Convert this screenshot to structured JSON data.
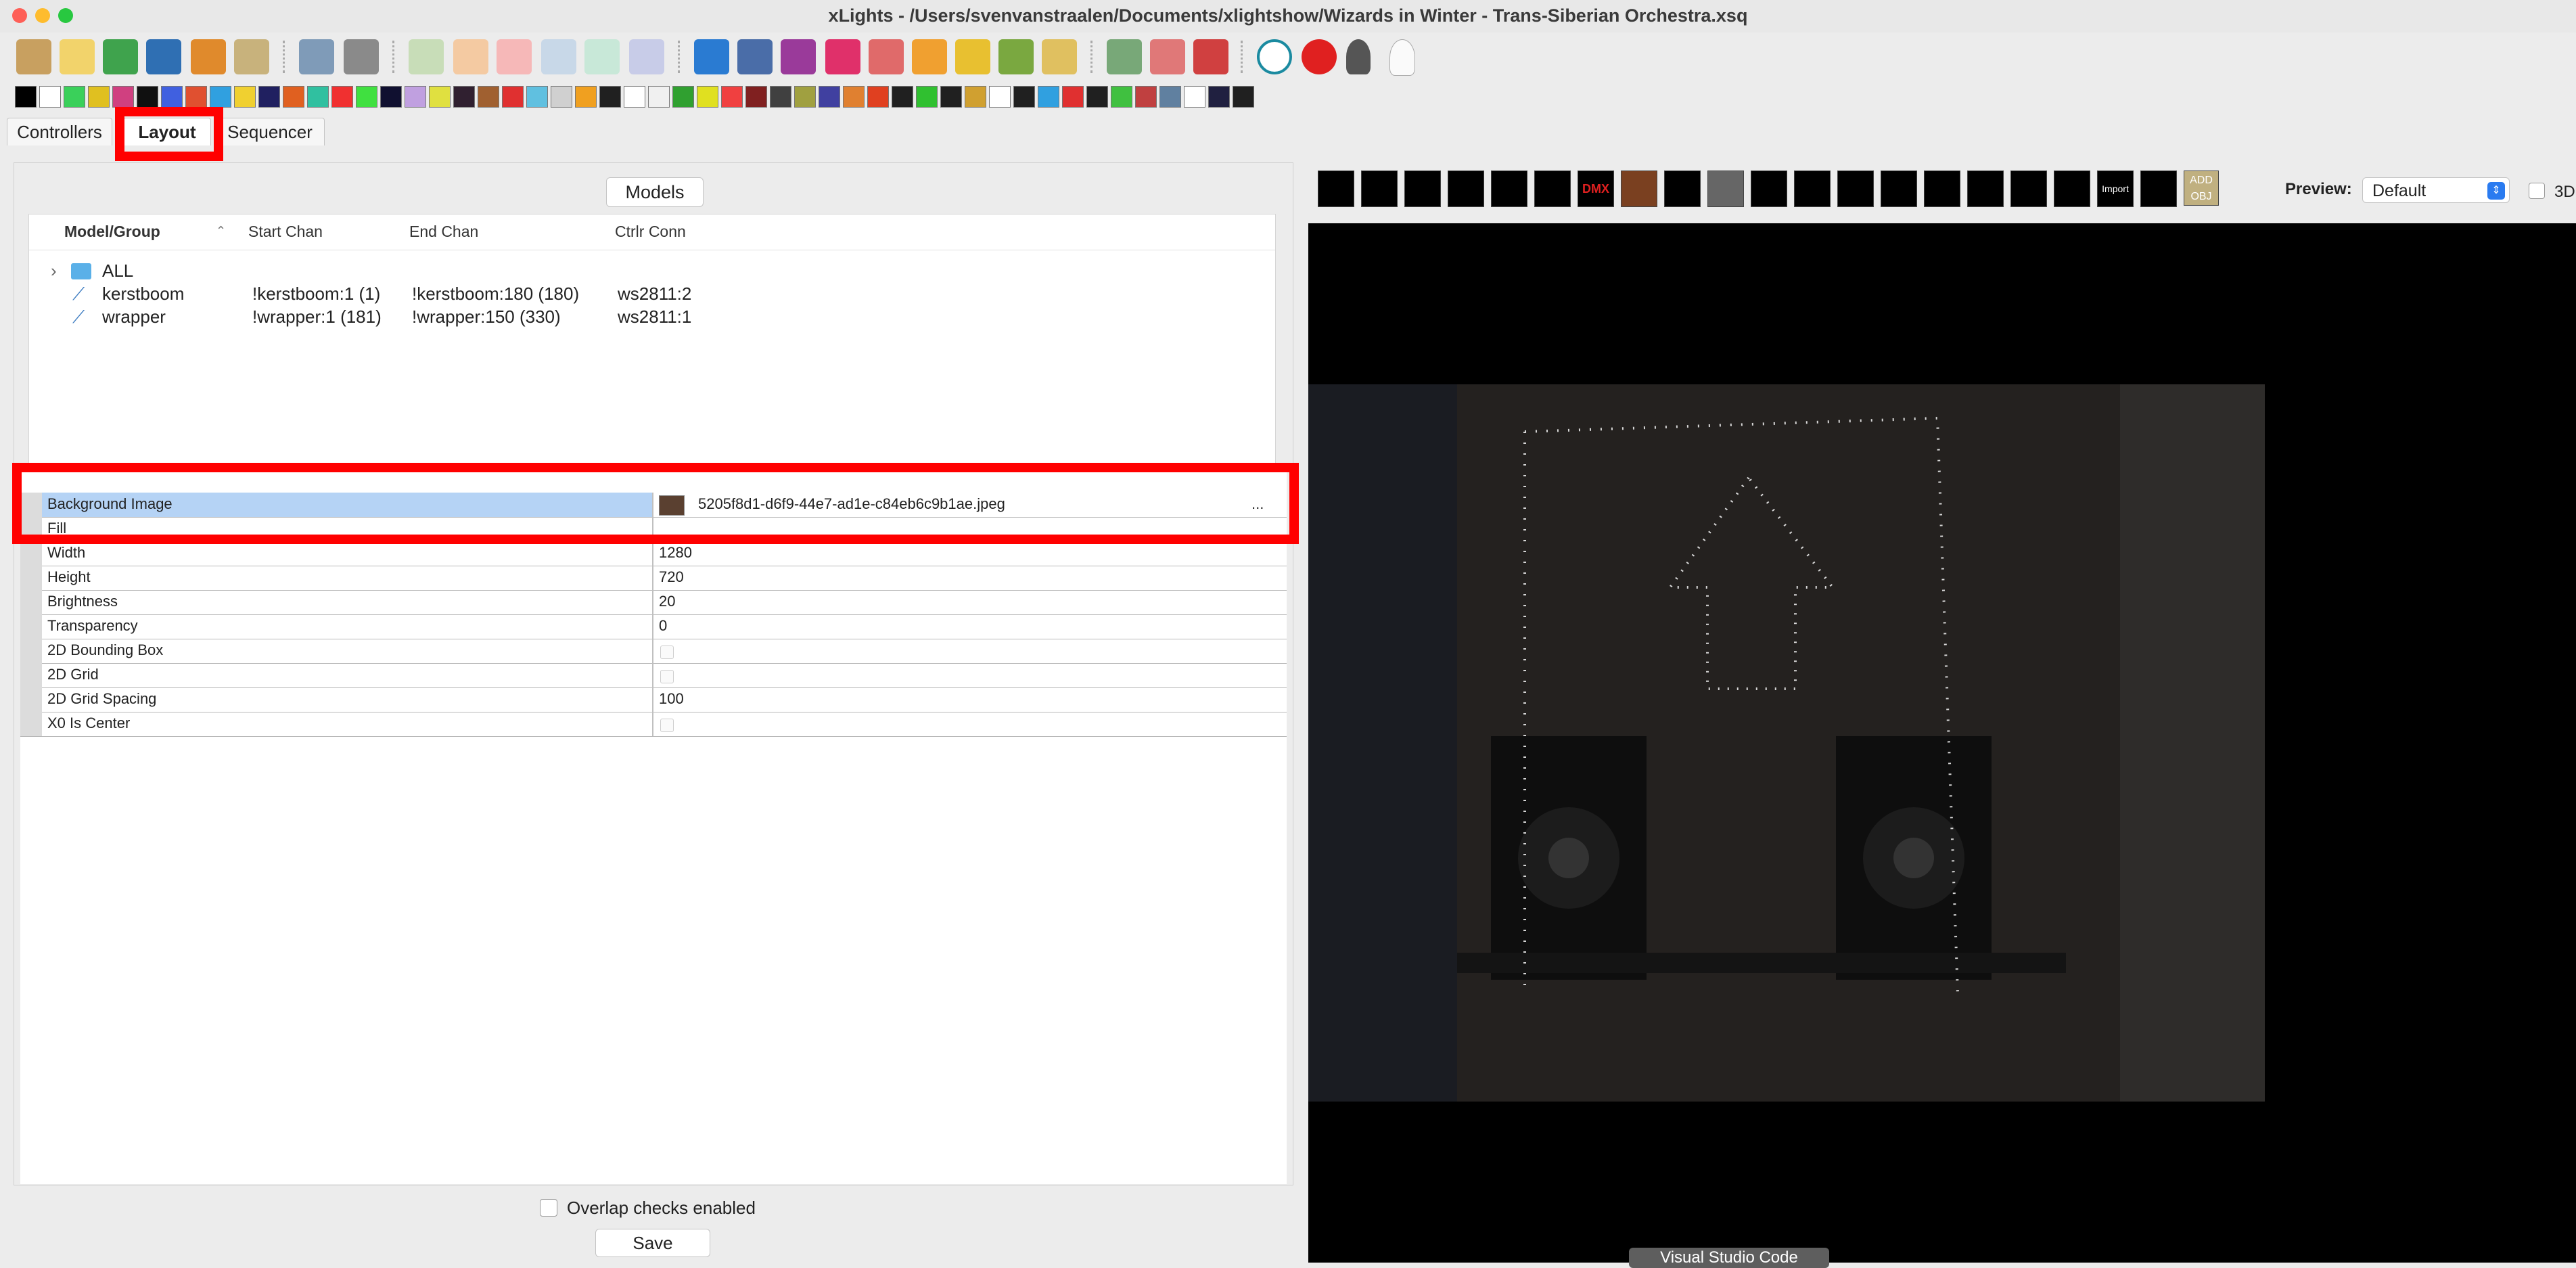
{
  "window": {
    "title": "xLights - /Users/svenvanstraalen/Documents/xlightshow/Wizards in Winter - Trans-Siberian Orchestra.xsq"
  },
  "tabs": [
    {
      "label": "Controllers"
    },
    {
      "label": "Layout"
    },
    {
      "label": "Sequencer"
    }
  ],
  "models_panel": {
    "button_label": "Models",
    "columns": [
      "Model/Group",
      "Start Chan",
      "End Chan",
      "Ctrlr Conn"
    ],
    "rows": [
      {
        "name": "ALL",
        "start": "",
        "end": "",
        "conn": ""
      },
      {
        "name": "kerstboom",
        "start": "!kerstboom:1 (1)",
        "end": "!kerstboom:180 (180)",
        "conn": "ws2811:2"
      },
      {
        "name": "wrapper",
        "start": "!wrapper:1 (181)",
        "end": "!wrapper:150 (330)",
        "conn": "ws2811:1"
      }
    ]
  },
  "properties": [
    {
      "name": "Background Image",
      "value": "5205f8d1-d6f9-44e7-ad1e-c84eb6c9b1ae.jpeg",
      "type": "file"
    },
    {
      "name": "Fill",
      "value": "",
      "type": "text"
    },
    {
      "name": "Width",
      "value": "1280",
      "type": "text"
    },
    {
      "name": "Height",
      "value": "720",
      "type": "text"
    },
    {
      "name": "Brightness",
      "value": "20",
      "type": "text"
    },
    {
      "name": "Transparency",
      "value": "0",
      "type": "text"
    },
    {
      "name": "2D Bounding Box",
      "value": "",
      "type": "check"
    },
    {
      "name": "2D Grid",
      "value": "",
      "type": "check"
    },
    {
      "name": "2D Grid Spacing",
      "value": "100",
      "type": "text"
    },
    {
      "name": "X0 Is Center",
      "value": "",
      "type": "check"
    }
  ],
  "file_picker_btn": "...",
  "overlap_label": "Overlap checks enabled",
  "save_label": "Save",
  "preview": {
    "label": "Preview:",
    "selected": "Default",
    "threed_label": "3D"
  },
  "shape_icons": [
    "arches-icon",
    "candy-cane-icon",
    "channel-block-icon",
    "circle-icon",
    "sphere-icon",
    "face-icon",
    "dmx-icon",
    "reindeer-icon",
    "icicles-icon",
    "matrix-icon",
    "single-line-icon",
    "poly-line-icon",
    "sphere-grid-icon",
    "spinner-icon",
    "star-icon",
    "tree-icon",
    "window-frame-icon",
    "wreath-icon",
    "import-icon",
    "download-icon",
    "add-object-icon"
  ],
  "import_text": "Import",
  "add_obj_text": "ADD OBJ",
  "dmx_text": "DMX",
  "tooltip": "Visual Studio Code"
}
